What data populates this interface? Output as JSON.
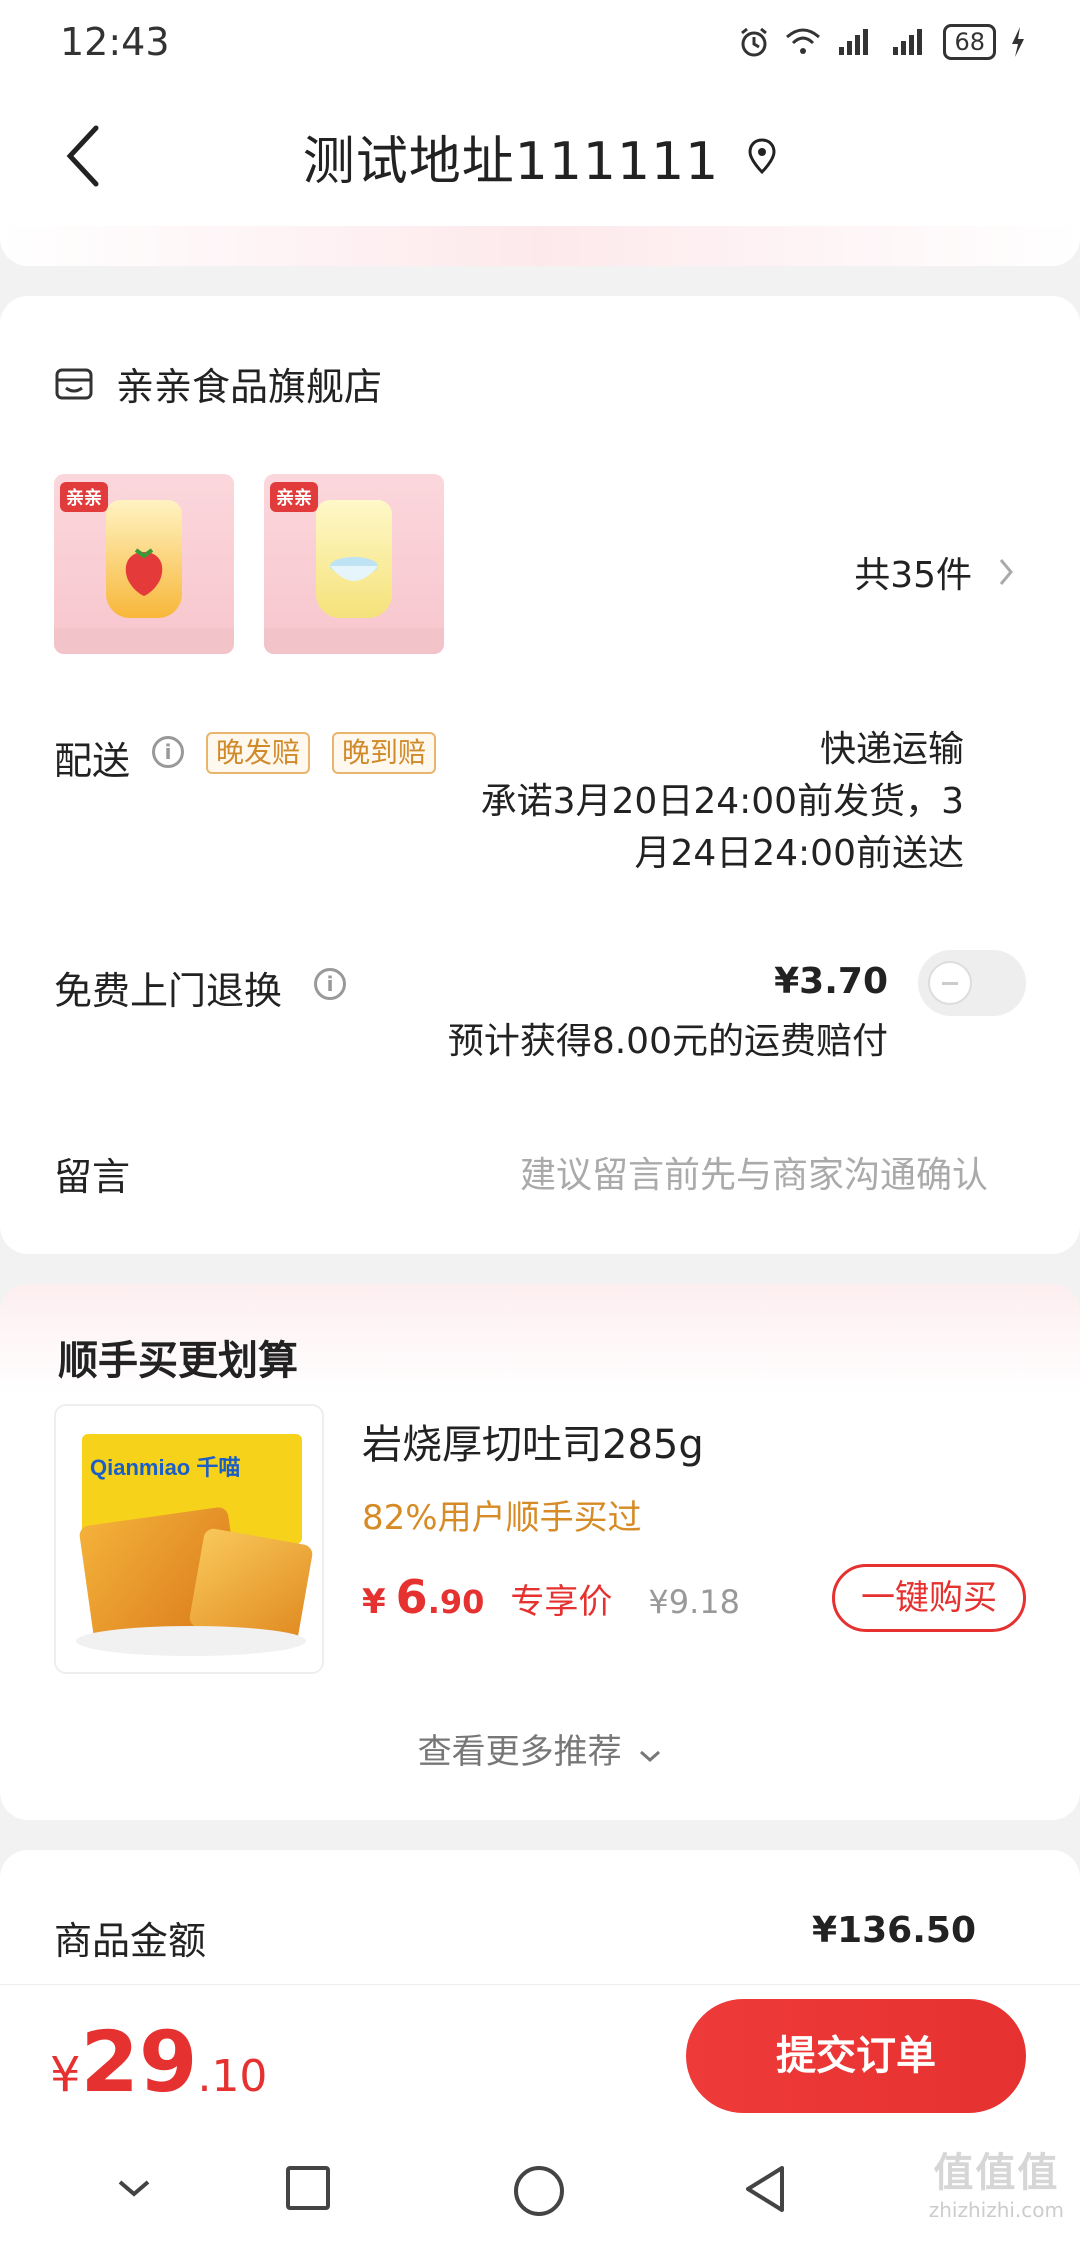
{
  "status_bar": {
    "time": "12:43",
    "network": "4G 4G",
    "battery": "68"
  },
  "header": {
    "title": "测试地址111111"
  },
  "store": {
    "name": "亲亲食品旗舰店",
    "products": [
      {
        "brand": "亲亲",
        "flavor_color": "#f0a43a"
      },
      {
        "brand": "亲亲",
        "flavor_color": "#9ad0e8"
      }
    ],
    "quantity": "共35件"
  },
  "delivery": {
    "label": "配送",
    "tags": [
      "晚发赔",
      "晚到赔"
    ],
    "method": "快递运输",
    "promise_line1": "承诺3月20日24:00前发货，3",
    "promise_line2": "月24日24:00前送达"
  },
  "return_service": {
    "label": "免费上门退换",
    "price": "¥3.70",
    "note": "预计获得8.00元的运费赔付",
    "enabled": false
  },
  "comment": {
    "label": "留言",
    "placeholder": "建议留言前先与商家沟通确认"
  },
  "recommend": {
    "title": "顺手买更划算",
    "item": {
      "name": "岩烧厚切吐司285g",
      "buyers": "82%用户顺手买过",
      "price_yen": "¥",
      "price_int": "6",
      "price_dec": ".90",
      "price_tag": "专享价",
      "old_price": "¥9.18",
      "buy_label": "一键购买",
      "brand_text": "Qianmiao 千喵"
    },
    "more_label": "查看更多推荐"
  },
  "amount": {
    "label": "商品金额",
    "value": "¥136.50"
  },
  "footer": {
    "total_yen": "¥",
    "total_int": "29",
    "total_dec": ".10",
    "submit_label": "提交订单"
  },
  "watermark": {
    "logo": "值值值",
    "site": "zhizhizhi.com"
  },
  "colors": {
    "accent": "#e5312f",
    "orange": "#d68b26"
  }
}
